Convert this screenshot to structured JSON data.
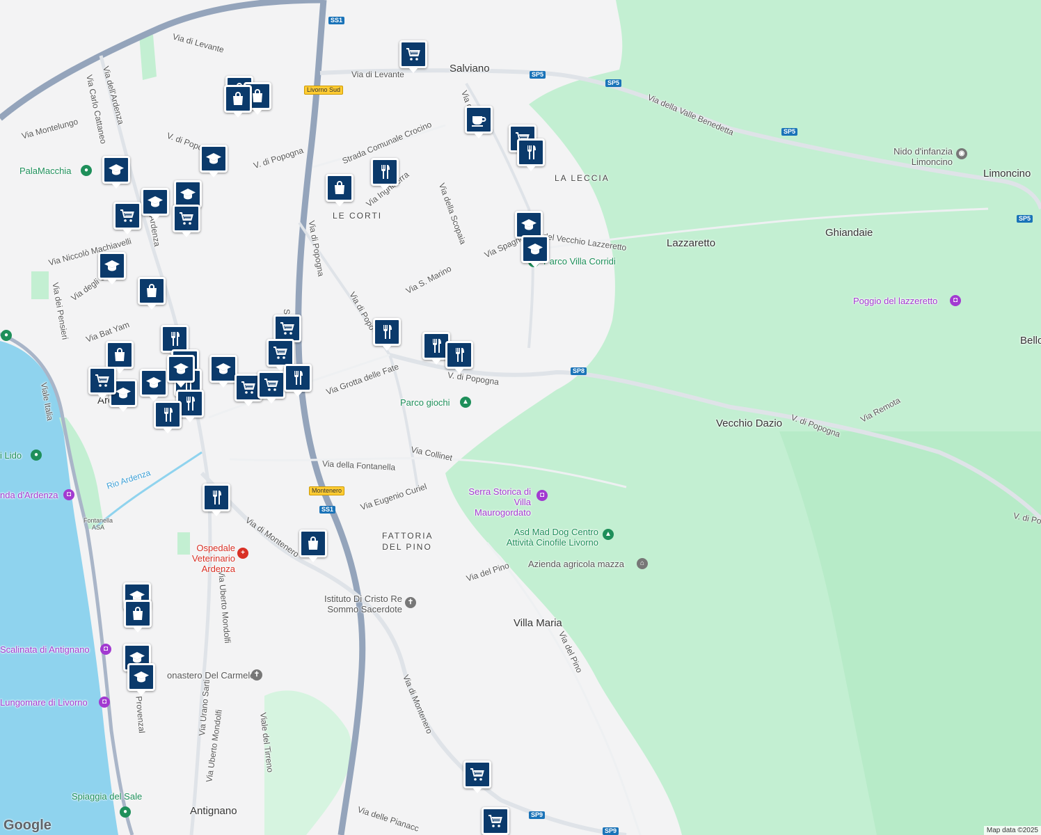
{
  "map": {
    "colors": {
      "land": "#f3f3f4",
      "water": "#8fd3ee",
      "forest": "#c3efd2",
      "highway": "#94a4bb",
      "road": "#ffffff",
      "marker": "#0b3a6b"
    },
    "places": [
      {
        "id": "salviano",
        "text": "Salviano"
      },
      {
        "id": "lazzaretto",
        "text": "Lazzaretto"
      },
      {
        "id": "ghiandaie",
        "text": "Ghiandaie"
      },
      {
        "id": "limoncino",
        "text": "Limoncino"
      },
      {
        "id": "vecchio-dazio",
        "text": "Vecchio Dazio"
      },
      {
        "id": "villa-maria",
        "text": "Villa Maria"
      },
      {
        "id": "antignano",
        "text": "Antignano"
      },
      {
        "id": "ardenza",
        "text": "Ardenza"
      },
      {
        "id": "bello",
        "text": "Bello"
      }
    ],
    "districts": [
      {
        "id": "la-leccia",
        "text": "LA LECCIA"
      },
      {
        "id": "le-corti",
        "text": "LE CORTI"
      },
      {
        "id": "fattoria-del-pino",
        "text": "FATTORIA DEL PINO"
      }
    ],
    "streets": [
      {
        "id": "via-di-levante-1",
        "text": "Via di Levante"
      },
      {
        "id": "via-di-levante-2",
        "text": "Via di Levante"
      },
      {
        "id": "via-dell-ardenza",
        "text": "Via dell'Ardenza"
      },
      {
        "id": "via-carlo-cattaneo",
        "text": "Via Carlo Cattaneo"
      },
      {
        "id": "via-montelungo",
        "text": "Via Montelungo"
      },
      {
        "id": "v-di-popogna-1",
        "text": "V. di Popogna"
      },
      {
        "id": "v-di-popogna-2",
        "text": "V. di Popogna"
      },
      {
        "id": "strada-crocino",
        "text": "Strada Comunale Crocino"
      },
      {
        "id": "via-inghilterra",
        "text": "Via Inghilterra"
      },
      {
        "id": "via-della-scopaia",
        "text": "Via della Scopaia"
      },
      {
        "id": "via-della-valle-benedetta",
        "text": "Via della Valle Benedetta"
      },
      {
        "id": "via-del-vecchio-lazzeretto",
        "text": "a del Vecchio Lazzeretto"
      },
      {
        "id": "via-spagna",
        "text": "Via Spagna"
      },
      {
        "id": "via-s-marino",
        "text": "Via S. Marino"
      },
      {
        "id": "via-di-popogna-1",
        "text": "Via di Popogna"
      },
      {
        "id": "via-di-popogna-2",
        "text": "Via di Popo"
      },
      {
        "id": "v-di-popogna-3",
        "text": "V. di Popogna"
      },
      {
        "id": "v-di-popogna-4",
        "text": "V. di Popogna"
      },
      {
        "id": "v-di-po-right",
        "text": "V. di Po"
      },
      {
        "id": "via-remota",
        "text": "Via Remota"
      },
      {
        "id": "via-grotta-delle-fate",
        "text": "Via Grotta delle Fate"
      },
      {
        "id": "via-niccolo-machiavelli",
        "text": "Via Niccolò Machiavelli"
      },
      {
        "id": "via-degli-ol",
        "text": "Via degli Ol"
      },
      {
        "id": "via-dei-pensieri",
        "text": "Via dei Pensieri"
      },
      {
        "id": "via-bat-yam",
        "text": "Via Bat Yam"
      },
      {
        "id": "viale-italia",
        "text": "Viale Italia"
      },
      {
        "id": "ardenza-st",
        "text": "Ardenza"
      },
      {
        "id": "via-collinet",
        "text": "Via Collinet"
      },
      {
        "id": "via-della-fontanella",
        "text": "Via della Fontanella"
      },
      {
        "id": "via-eugenio-curiel",
        "text": "Via Eugenio Curiel"
      },
      {
        "id": "via-di-montenero-1",
        "text": "Via di Montenero"
      },
      {
        "id": "via-di-montenero-2",
        "text": "Via di Montenero"
      },
      {
        "id": "via-uberto-mondolfi-1",
        "text": "Via Uberto Mondolfi"
      },
      {
        "id": "via-uberto-mondolfi-2",
        "text": "Via Uberto Mondolfi"
      },
      {
        "id": "via-del-pino-1",
        "text": "Via del Pino"
      },
      {
        "id": "via-del-pino-2",
        "text": "Via del Pino"
      },
      {
        "id": "via-urano-sarti",
        "text": "Via Urano Sarti"
      },
      {
        "id": "viale-del-tirreno",
        "text": "Viale del Tirreno"
      },
      {
        "id": "provenzal",
        "text": "Provenzal"
      },
      {
        "id": "via-delle-pianacce",
        "text": "Via delle Pianacc"
      },
      {
        "id": "rio-ardenza",
        "text": "Rio Ardenza"
      },
      {
        "id": "fontanella-asa",
        "text": "Fontanella ASA"
      },
      {
        "id": "viale-ss1",
        "text": "SS"
      },
      {
        "id": "via-dello-ala",
        "text": "Via d... ala"
      }
    ],
    "pois": [
      {
        "id": "palamacchia",
        "text": "PalaMacchia",
        "kind": "green"
      },
      {
        "id": "parco-villa-corridi",
        "text": "Parco Villa Corridi",
        "kind": "green"
      },
      {
        "id": "parco-giochi",
        "text": "Parco giochi",
        "kind": "green"
      },
      {
        "id": "nido-limoncino",
        "text": "Nido d'infanzia Limoncino",
        "kind": "grey"
      },
      {
        "id": "poggio-lazzeretto",
        "text": "Poggio del lazzeretto",
        "kind": "purple"
      },
      {
        "id": "serra-storica",
        "text": "Serra Storica di Villa Maurogordato",
        "kind": "purple"
      },
      {
        "id": "asd-mad-dog",
        "text": "Asd Mad Dog Centro Attività Cinofile Livorno",
        "kind": "green"
      },
      {
        "id": "azienda-agricola",
        "text": "Azienda agricola mazza",
        "kind": "grey"
      },
      {
        "id": "istituto-cristo-re",
        "text": "Istituto Di Cristo Re Sommo Sacerdote",
        "kind": "grey"
      },
      {
        "id": "ospedale-veterinario",
        "text": "Ospedale Veterinario Ardenza",
        "kind": "red"
      },
      {
        "id": "monastero-carmelo",
        "text": "onastero Del Carmelo",
        "kind": "grey"
      },
      {
        "id": "scalinata-antignano",
        "text": "Scalinata di Antignano",
        "kind": "purple"
      },
      {
        "id": "lungomare-livorno",
        "text": "Lungomare di Livorno",
        "kind": "purple"
      },
      {
        "id": "spiaggia-del-sale",
        "text": "Spiaggia del Sale",
        "kind": "green"
      },
      {
        "id": "i-lido",
        "text": "i Lido",
        "kind": "green"
      },
      {
        "id": "nda-d-ardenza",
        "text": "nda d'Ardenza",
        "kind": "purple"
      }
    ],
    "road_shields": [
      {
        "id": "ss1-top",
        "text": "SS1"
      },
      {
        "id": "sp5-a",
        "text": "SP5"
      },
      {
        "id": "sp5-b",
        "text": "SP5"
      },
      {
        "id": "sp5-c",
        "text": "SP5"
      },
      {
        "id": "sp5-d",
        "text": "SP5"
      },
      {
        "id": "sp8",
        "text": "SP8"
      },
      {
        "id": "ss1-bottom",
        "text": "SS1"
      },
      {
        "id": "sp9-a",
        "text": "SP9"
      },
      {
        "id": "sp9-b",
        "text": "SP9"
      }
    ],
    "exit_signs": [
      {
        "id": "livorno-sud",
        "text": "Livorno Sud"
      },
      {
        "id": "montenero",
        "text": "Montenero"
      }
    ],
    "markers": [
      {
        "id": "m1",
        "icon": "cart"
      },
      {
        "id": "m2",
        "icon": "bag"
      },
      {
        "id": "m3",
        "icon": "bag"
      },
      {
        "id": "m4",
        "icon": "bag"
      },
      {
        "id": "m5",
        "icon": "coffee"
      },
      {
        "id": "m6",
        "icon": "cart"
      },
      {
        "id": "m7",
        "icon": "fork"
      },
      {
        "id": "m8",
        "icon": "grad"
      },
      {
        "id": "m9",
        "icon": "grad"
      },
      {
        "id": "m10",
        "icon": "fork"
      },
      {
        "id": "m11",
        "icon": "bag"
      },
      {
        "id": "m12",
        "icon": "grad"
      },
      {
        "id": "m13",
        "icon": "grad"
      },
      {
        "id": "m14",
        "icon": "cart"
      },
      {
        "id": "m15",
        "icon": "cart"
      },
      {
        "id": "m16",
        "icon": "grad"
      },
      {
        "id": "m17",
        "icon": "grad"
      },
      {
        "id": "m18",
        "icon": "grad"
      },
      {
        "id": "m19",
        "icon": "bag"
      },
      {
        "id": "m20",
        "icon": "fork"
      },
      {
        "id": "m21",
        "icon": "fork"
      },
      {
        "id": "m22",
        "icon": "fork"
      },
      {
        "id": "m23",
        "icon": "fork"
      },
      {
        "id": "m24",
        "icon": "bag"
      },
      {
        "id": "m25",
        "icon": "cart"
      },
      {
        "id": "m26",
        "icon": "grad"
      },
      {
        "id": "m27",
        "icon": "cart"
      },
      {
        "id": "m28",
        "icon": "grad"
      },
      {
        "id": "m29",
        "icon": "fork"
      },
      {
        "id": "m30",
        "icon": "cart"
      },
      {
        "id": "m31",
        "icon": "cart"
      },
      {
        "id": "m32",
        "icon": "fork"
      },
      {
        "id": "m33",
        "icon": "grad"
      },
      {
        "id": "m34",
        "icon": "fork"
      },
      {
        "id": "m35",
        "icon": "fork"
      },
      {
        "id": "m36",
        "icon": "fork"
      },
      {
        "id": "m37",
        "icon": "bag"
      },
      {
        "id": "m38",
        "icon": "grad"
      },
      {
        "id": "m39",
        "icon": "bag"
      },
      {
        "id": "m40",
        "icon": "grad"
      },
      {
        "id": "m41",
        "icon": "grad"
      },
      {
        "id": "m42",
        "icon": "cart"
      },
      {
        "id": "m43",
        "icon": "cart"
      },
      {
        "id": "m44",
        "icon": "grad"
      },
      {
        "id": "m45",
        "icon": "cart"
      },
      {
        "id": "m46",
        "icon": "fork"
      }
    ],
    "attribution": {
      "logo": "Google",
      "data": "Map data ©2025"
    }
  }
}
